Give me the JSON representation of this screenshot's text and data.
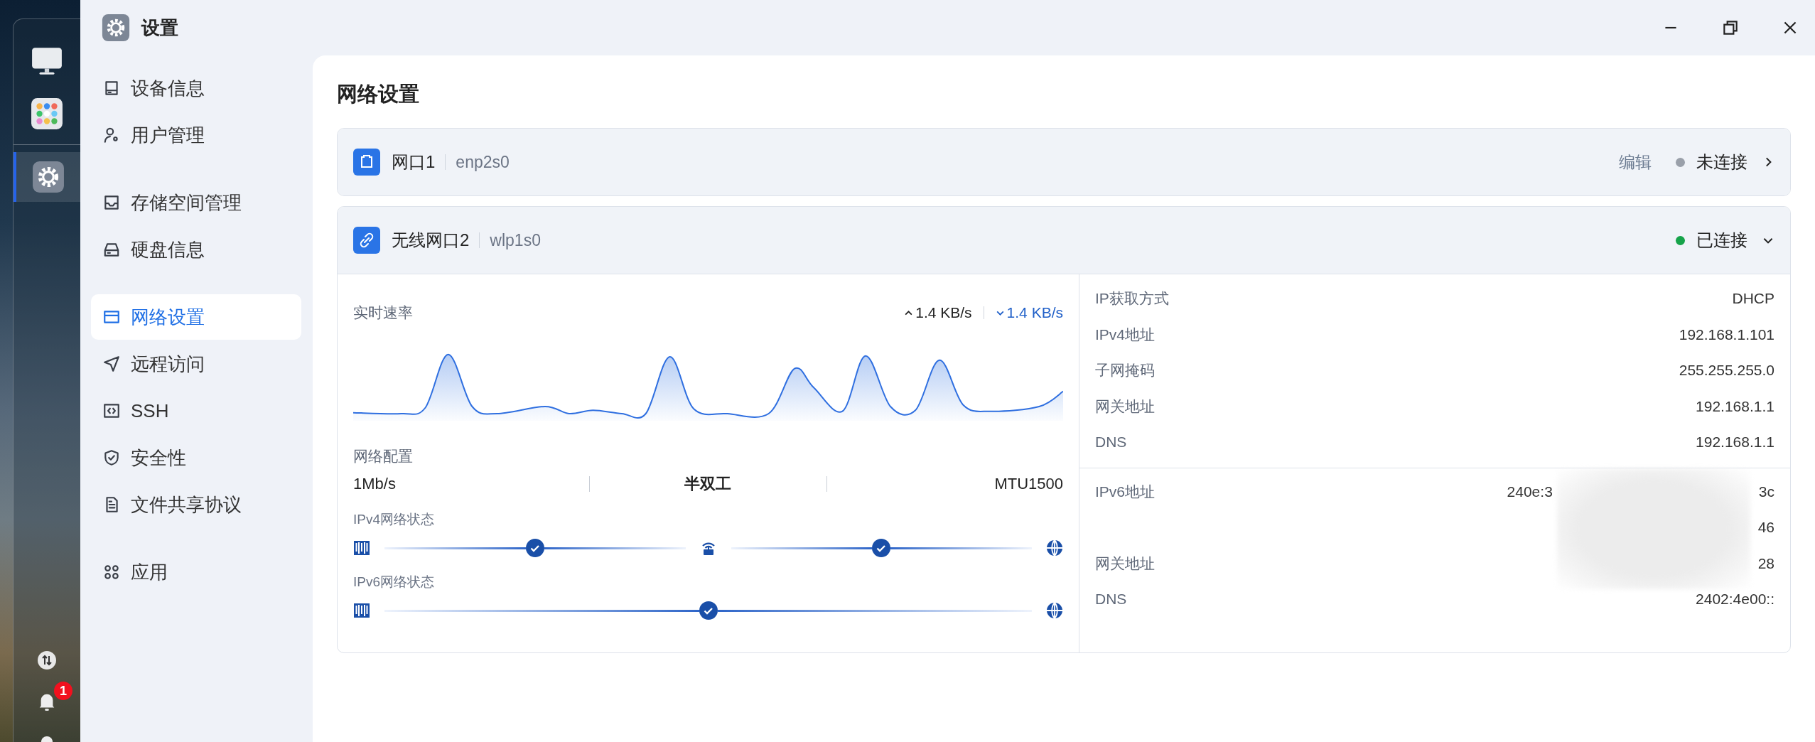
{
  "window": {
    "title": "设置"
  },
  "dock": {
    "badge": "1"
  },
  "sidebar": {
    "groups": [
      [
        {
          "label": "设备信息",
          "selected": false
        },
        {
          "label": "用户管理",
          "selected": false
        }
      ],
      [
        {
          "label": "存储空间管理",
          "selected": false
        },
        {
          "label": "硬盘信息",
          "selected": false
        }
      ],
      [
        {
          "label": "网络设置",
          "selected": true
        },
        {
          "label": "远程访问",
          "selected": false
        },
        {
          "label": "SSH",
          "selected": false
        },
        {
          "label": "安全性",
          "selected": false
        },
        {
          "label": "文件共享协议",
          "selected": false
        }
      ],
      [
        {
          "label": "应用",
          "selected": false
        }
      ]
    ]
  },
  "page_title": "网络设置",
  "interfaces": [
    {
      "kind": "wired",
      "name": "网口1",
      "device": "enp2s0",
      "edit": "编辑",
      "status": "未连接",
      "connected": false,
      "expanded": false
    },
    {
      "kind": "wireless",
      "name": "无线网口2",
      "device": "wlp1s0",
      "status": "已连接",
      "connected": true,
      "expanded": true,
      "details": {
        "speed": {
          "title": "实时速率",
          "up": "1.4 KB/s",
          "down": "1.4 KB/s"
        },
        "config": {
          "title": "网络配置",
          "values": [
            "1Mb/s",
            "半双工",
            "MTU1500"
          ]
        },
        "status": [
          {
            "title": "IPv4网络状态",
            "nodes": [
              {
                "kind": "server"
              },
              {
                "kind": "check"
              },
              {
                "kind": "router"
              },
              {
                "kind": "check"
              },
              {
                "kind": "globe"
              }
            ]
          },
          {
            "title": "IPv6网络状态",
            "nodes": [
              {
                "kind": "server"
              },
              {
                "kind": "check"
              },
              {
                "kind": "globe"
              }
            ]
          }
        ],
        "ipv4": [
          {
            "label": "IP获取方式",
            "value": "DHCP"
          },
          {
            "label": "IPv4地址",
            "value": "192.168.1.101"
          },
          {
            "label": "子网掩码",
            "value": "255.255.255.0"
          },
          {
            "label": "网关地址",
            "value": "192.168.1.1"
          },
          {
            "label": "DNS",
            "value": "192.168.1.1"
          }
        ],
        "ipv6": [
          {
            "label": "IPv6地址",
            "value": "240e:3",
            "tail": "3c"
          },
          {
            "tail": "46"
          },
          {
            "label": "网关地址",
            "tail": "28"
          },
          {
            "label": "DNS",
            "value": "2402:4e00::"
          }
        ]
      }
    }
  ]
}
